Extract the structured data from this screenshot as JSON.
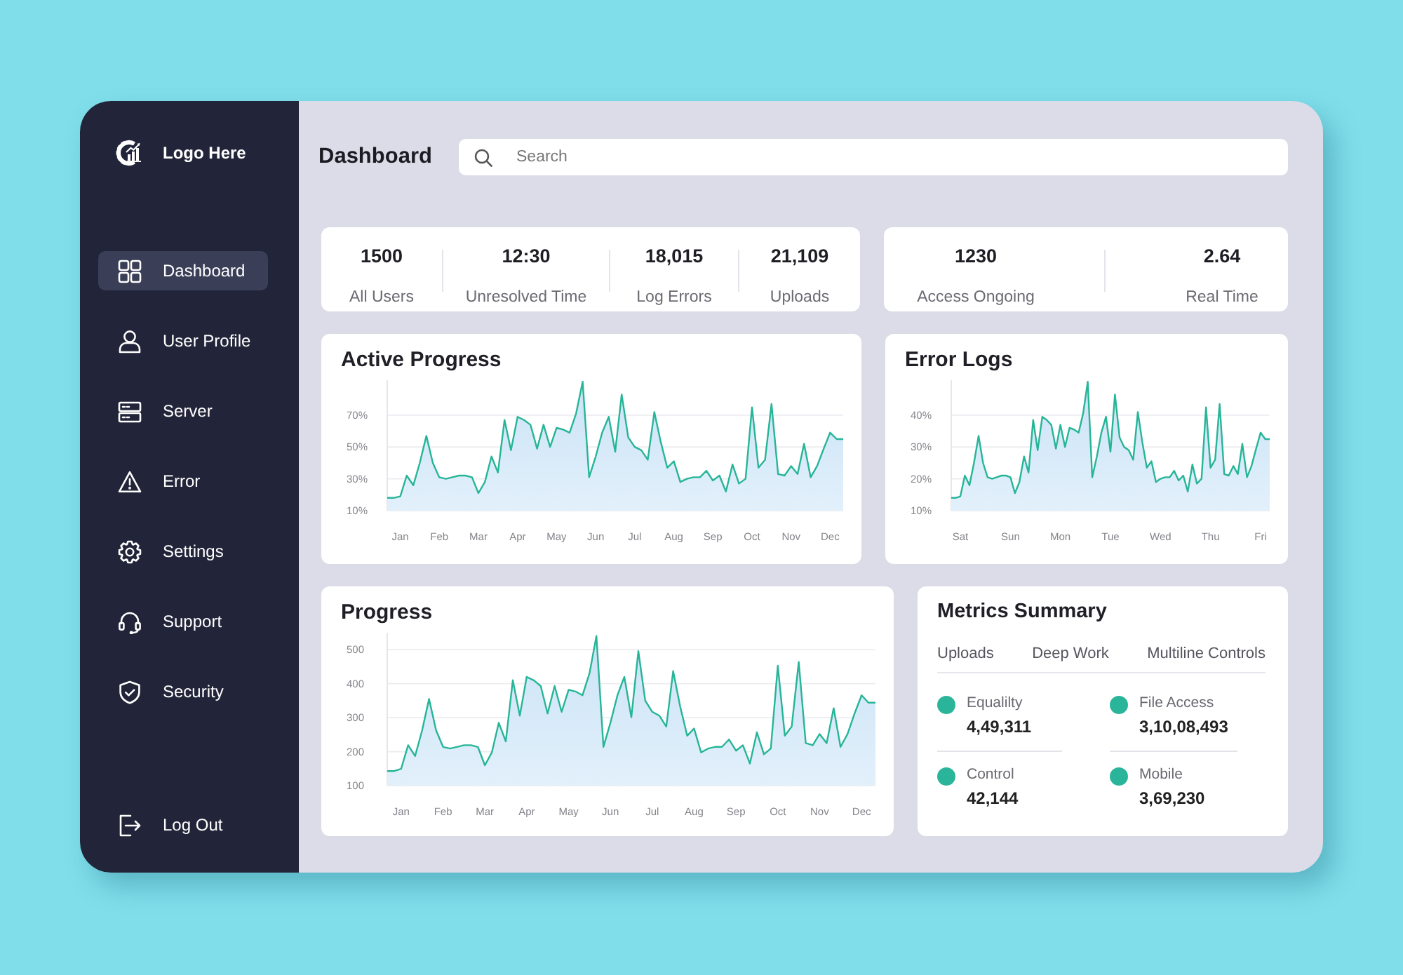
{
  "sidebar": {
    "logo_text": "Logo Here",
    "items": [
      {
        "kind": "dashboard",
        "label": "Dashboard",
        "selected": true
      },
      {
        "kind": "profile",
        "label": "User Profile",
        "selected": false
      },
      {
        "kind": "server",
        "label": "Server",
        "selected": false
      },
      {
        "kind": "error",
        "label": "Error",
        "selected": false
      },
      {
        "kind": "settings",
        "label": "Settings",
        "selected": false
      },
      {
        "kind": "support",
        "label": "Support",
        "selected": false
      },
      {
        "kind": "security",
        "label": "Security",
        "selected": false
      }
    ],
    "logout": {
      "label": "Log Out"
    }
  },
  "header": {
    "title": "Dashboard",
    "search": {
      "placeholder": "Search"
    }
  },
  "stats": [
    {
      "items": [
        {
          "value": "1500",
          "label": "All Users"
        },
        {
          "value": "12:30",
          "label": "Unresolved Time"
        },
        {
          "value": "18,015",
          "label": "Log Errors"
        },
        {
          "value": "21,109",
          "label": "Uploads"
        }
      ]
    },
    {
      "items": [
        {
          "value": "1230",
          "label": "Access Ongoing"
        },
        {
          "value": "2.64",
          "label": "Real Time"
        }
      ]
    }
  ],
  "active_progress": {
    "title": "Active Progress",
    "chart_data": {
      "type": "area",
      "grid": true,
      "categories": [
        null,
        null,
        "Jan",
        null,
        null,
        null,
        null,
        null,
        "Feb",
        null,
        null,
        null,
        null,
        null,
        "Mar",
        null,
        null,
        null,
        null,
        null,
        "Apr",
        null,
        null,
        null,
        null,
        null,
        "May",
        null,
        null,
        null,
        null,
        null,
        "Jun",
        null,
        null,
        null,
        null,
        null,
        "Jul",
        null,
        null,
        null,
        null,
        null,
        "Aug",
        null,
        null,
        null,
        null,
        null,
        "Sep",
        null,
        null,
        null,
        null,
        null,
        "Oct",
        null,
        null,
        null,
        null,
        null,
        "Nov",
        null,
        null,
        null,
        null,
        null,
        "Dec",
        null,
        null
      ],
      "series": [
        {
          "color": "#27b597",
          "values": [
            18,
            18,
            19,
            32,
            26,
            40,
            57,
            40,
            31,
            30,
            31,
            32,
            32,
            31,
            21,
            28,
            44,
            34,
            67,
            48,
            69,
            67,
            64,
            49,
            64,
            50,
            62,
            61,
            59,
            71,
            91,
            31,
            44,
            59,
            69,
            47,
            83,
            56,
            50,
            48,
            42,
            72,
            53,
            37,
            41,
            28,
            30,
            31,
            31,
            35,
            29,
            32,
            22,
            39,
            27,
            30,
            75,
            37,
            42,
            77,
            33,
            32,
            38,
            33,
            52,
            31,
            38,
            49,
            59,
            55,
            55
          ]
        }
      ],
      "ylim": [
        10,
        92
      ],
      "yticks": [
        {
          "value": 10,
          "label": "10%"
        },
        {
          "value": 30,
          "label": "30%"
        },
        {
          "value": 50,
          "label": "50%"
        },
        {
          "value": 70,
          "label": "70%"
        }
      ]
    }
  },
  "error_logs": {
    "title": "Error Logs",
    "chart_data": {
      "type": "area",
      "grid": true,
      "categories": [
        null,
        null,
        "Sat",
        null,
        null,
        null,
        null,
        null,
        null,
        null,
        null,
        null,
        null,
        "Sun",
        null,
        null,
        null,
        null,
        null,
        null,
        null,
        null,
        null,
        null,
        "Mon",
        null,
        null,
        null,
        null,
        null,
        null,
        null,
        null,
        null,
        null,
        "Tue",
        null,
        null,
        null,
        null,
        null,
        null,
        null,
        null,
        null,
        null,
        "Wed",
        null,
        null,
        null,
        null,
        null,
        null,
        null,
        null,
        null,
        null,
        "Thu",
        null,
        null,
        null,
        null,
        null,
        null,
        null,
        null,
        null,
        null,
        "Fri",
        null,
        null
      ],
      "series": [
        {
          "color": "#27b597",
          "values": [
            14,
            14,
            14.5,
            21,
            18,
            25,
            33.5,
            25,
            20.5,
            20,
            20.5,
            21,
            21,
            20.5,
            15.5,
            19,
            27,
            22,
            38.5,
            29,
            39.5,
            38.5,
            37,
            29.5,
            37,
            30,
            36,
            35.5,
            34.5,
            40.5,
            50.5,
            20.5,
            27,
            34.5,
            39.5,
            28.5,
            46.5,
            33,
            30,
            29,
            26,
            41,
            31.5,
            23.5,
            25.5,
            19,
            20,
            20.5,
            20.5,
            22.5,
            19.5,
            21,
            16,
            24.5,
            18.5,
            20,
            42.5,
            23.5,
            26,
            43.5,
            21.5,
            21,
            24,
            21.5,
            31,
            20.5,
            24,
            29.5,
            34.5,
            32.5,
            32.5
          ]
        }
      ],
      "ylim": [
        10,
        51
      ],
      "yticks": [
        {
          "value": 10,
          "label": "10%"
        },
        {
          "value": 20,
          "label": "20%"
        },
        {
          "value": 30,
          "label": "30%"
        },
        {
          "value": 40,
          "label": "40%"
        }
      ]
    }
  },
  "progress": {
    "title": "Progress",
    "chart_data": {
      "type": "area",
      "grid": true,
      "categories": [
        null,
        null,
        "Jan",
        null,
        null,
        null,
        null,
        null,
        "Feb",
        null,
        null,
        null,
        null,
        null,
        "Mar",
        null,
        null,
        null,
        null,
        null,
        "Apr",
        null,
        null,
        null,
        null,
        null,
        "May",
        null,
        null,
        null,
        null,
        null,
        "Jun",
        null,
        null,
        null,
        null,
        null,
        "Jul",
        null,
        null,
        null,
        null,
        null,
        "Aug",
        null,
        null,
        null,
        null,
        null,
        "Sep",
        null,
        null,
        null,
        null,
        null,
        "Oct",
        null,
        null,
        null,
        null,
        null,
        "Nov",
        null,
        null,
        null,
        null,
        null,
        "Dec",
        null,
        null
      ],
      "series": [
        {
          "color": "#27b597",
          "values": [
            143,
            143,
            149,
            219,
            187,
            263,
            355,
            263,
            214,
            209,
            214,
            219,
            219,
            214,
            160,
            198,
            285,
            230,
            410,
            306,
            420,
            410,
            393,
            312,
            393,
            317,
            382,
            377,
            366,
            431,
            540,
            214,
            285,
            366,
            420,
            301,
            496,
            350,
            317,
            306,
            274,
            437,
            333,
            247,
            268,
            198,
            209,
            214,
            214,
            236,
            203,
            219,
            165,
            257,
            192,
            209,
            453,
            247,
            274,
            464,
            225,
            219,
            252,
            225,
            328,
            214,
            252,
            312,
            366,
            344,
            344
          ]
        }
      ],
      "ylim": [
        100,
        550
      ],
      "yticks": [
        100,
        200,
        300,
        400,
        500
      ]
    }
  },
  "metrics_summary": {
    "title": "Metrics Summary",
    "tabs": [
      "Uploads",
      "Deep Work",
      "Multiline Controls"
    ],
    "items": [
      {
        "label": "Equalilty",
        "value": "4,49,311"
      },
      {
        "label": "File Access",
        "value": "3,10,08,493"
      },
      {
        "label": "Control",
        "value": "42,144"
      },
      {
        "label": "Mobile",
        "value": "3,69,230"
      }
    ]
  }
}
